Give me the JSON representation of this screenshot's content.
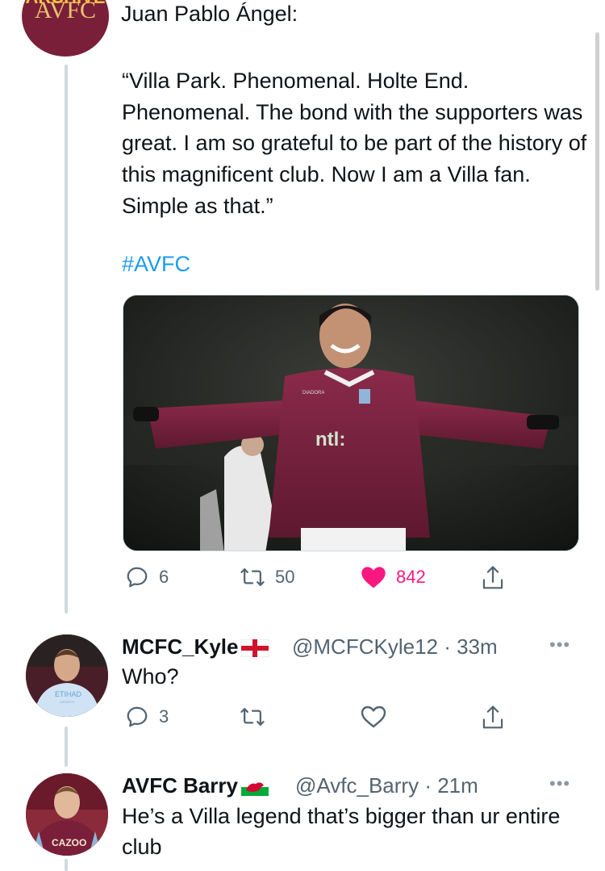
{
  "main_tweet": {
    "avatar_text_top": "AVFC",
    "avatar_text_bottom": "ARCHIVE",
    "author_line": "Juan Pablo Ángel:",
    "quote": "“Villa Park. Phenomenal. Holte End. Phenomenal. The bond with the supporters was great. I am so grateful to be part of the history of this magnificent club. Now I am a Villa fan. Simple as that.”",
    "hashtag": "#AVFC",
    "photo_sponsor": "ntl:",
    "photo_kit_brand": "DIADORA",
    "actions": {
      "replies": "6",
      "retweets": "50",
      "likes": "842",
      "liked": true
    }
  },
  "replies": [
    {
      "name": "MCFC_Kyle",
      "flag": "england-flag",
      "handle": "@MCFCKyle12",
      "time": "· 33m",
      "text": "Who?",
      "replies": "3",
      "avatar_shirt_text": "ETIHAD",
      "avatar_shirt_sub": "AIRWAYS"
    },
    {
      "name": "AVFC Barry",
      "flag": "wales-flag",
      "handle": "@Avfc_Barry",
      "time": "· 21m",
      "text": "He’s a Villa legend that’s bigger than ur entire club",
      "avatar_shirt_text": "CAZOO"
    }
  ],
  "colors": {
    "accent": "#1d9bf0",
    "like": "#f91880",
    "muted": "#536471",
    "avatar_bg": "#7a1f3a"
  }
}
